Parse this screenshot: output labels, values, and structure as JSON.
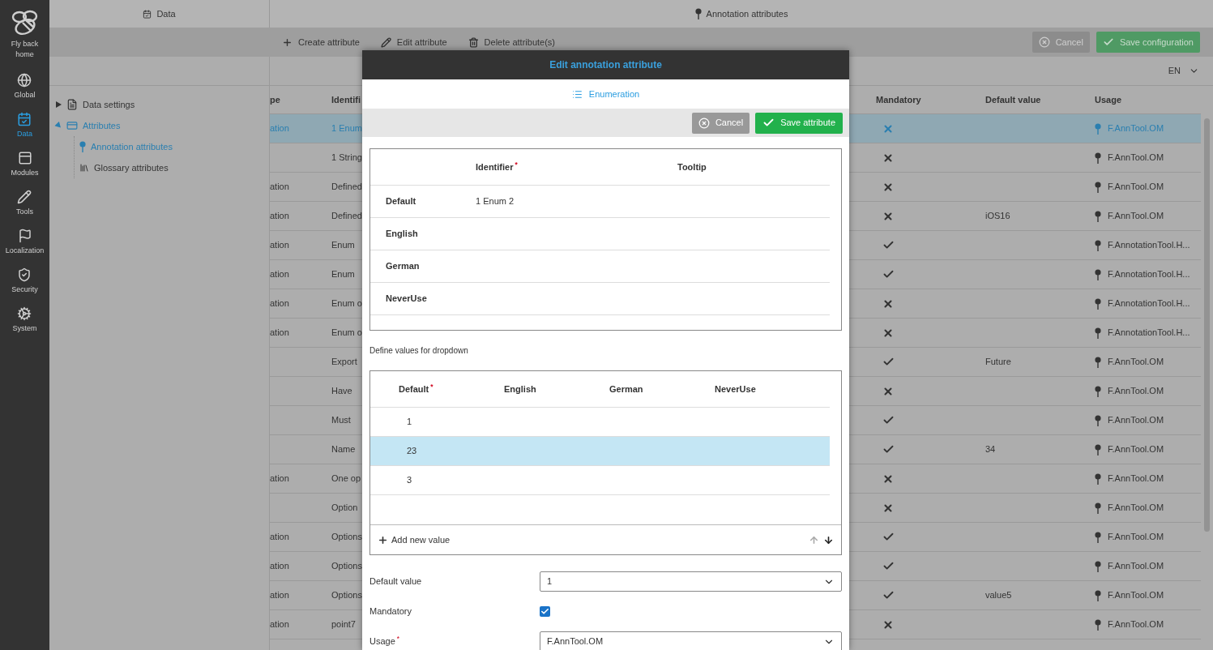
{
  "nav": {
    "home_label": "Fly back home",
    "items": [
      {
        "label": "Global",
        "selected": false
      },
      {
        "label": "Data",
        "selected": true
      },
      {
        "label": "Modules",
        "selected": false
      },
      {
        "label": "Tools",
        "selected": false
      },
      {
        "label": "Localization",
        "selected": false
      },
      {
        "label": "Security",
        "selected": false
      },
      {
        "label": "System",
        "selected": false
      }
    ]
  },
  "data_panel": {
    "title": "Data",
    "tree": [
      {
        "label": "Data settings",
        "expanded": false
      },
      {
        "label": "Attributes",
        "expanded": true,
        "children": [
          {
            "label": "Annotation attributes",
            "selected": true
          },
          {
            "label": "Glossary attributes",
            "selected": false
          }
        ]
      }
    ]
  },
  "main": {
    "title": "Annotation attributes",
    "toolbar": [
      "Create attribute",
      "Edit attribute",
      "Delete attribute(s)"
    ],
    "cancel": "Cancel",
    "save": "Save configuration",
    "language": "EN",
    "table": {
      "columns": [
        "pe",
        "Identifi",
        "Mandatory",
        "Default value",
        "Usage"
      ],
      "rows": [
        {
          "type": "ation",
          "identifier": "1 Enum",
          "mandatory": false,
          "usage": "F.AnnTool.OM",
          "selected": true
        },
        {
          "identifier": "1 String",
          "mandatory": false,
          "usage": "F.AnnTool.OM",
          "selected": false
        },
        {
          "type": "ation",
          "identifier": "Defined",
          "mandatory": false,
          "usage": "F.AnnTool.OM",
          "selected": false
        },
        {
          "type": "ation",
          "identifier": "Defined",
          "mandatory": false,
          "default_value": "iOS16",
          "usage": "F.AnnTool.OM",
          "selected": false
        },
        {
          "type": "ation",
          "identifier": "Enum",
          "mandatory": true,
          "usage": "F.AnnotationTool.H...",
          "selected": false
        },
        {
          "type": "ation",
          "identifier": "Enum",
          "mandatory": true,
          "usage": "F.AnnotationTool.H...",
          "selected": false
        },
        {
          "type": "ation",
          "identifier": "Enum o",
          "mandatory": false,
          "usage": "F.AnnotationTool.H...",
          "selected": false
        },
        {
          "type": "ation",
          "identifier": "Enum o",
          "mandatory": false,
          "usage": "F.AnnotationTool.H...",
          "selected": false
        },
        {
          "identifier": "Export",
          "mandatory": true,
          "default_value": "Future",
          "usage": "F.AnnTool.OM",
          "selected": false
        },
        {
          "identifier": "Have",
          "mandatory": false,
          "usage": "F.AnnTool.OM",
          "selected": false
        },
        {
          "identifier": "Must",
          "mandatory": true,
          "usage": "F.AnnTool.OM",
          "selected": false
        },
        {
          "identifier": "Name",
          "mandatory": true,
          "default_value": "34",
          "usage": "F.AnnTool.OM",
          "selected": false
        },
        {
          "type": "ation",
          "identifier": "One op",
          "mandatory": false,
          "usage": "F.AnnTool.OM",
          "selected": false
        },
        {
          "identifier": "Option",
          "mandatory": false,
          "usage": "F.AnnTool.OM",
          "selected": false
        },
        {
          "type": "ation",
          "identifier": "Options",
          "mandatory": true,
          "usage": "F.AnnTool.OM",
          "selected": false
        },
        {
          "type": "ation",
          "identifier": "Options",
          "mandatory": true,
          "usage": "F.AnnTool.OM",
          "selected": false
        },
        {
          "type": "ation",
          "identifier": "Options",
          "mandatory": true,
          "default_value": "value5",
          "usage": "F.AnnTool.OM",
          "selected": false
        },
        {
          "type": "ation",
          "identifier": "point7",
          "mandatory": false,
          "usage": "F.AnnTool.OM",
          "selected": false
        }
      ]
    }
  },
  "dialog": {
    "title": "Edit annotation attribute",
    "type_label": "Enumeration",
    "cancel": "Cancel",
    "save": "Save attribute",
    "translations": {
      "columns": [
        "Identifier$^{*}$",
        "Tooltip"
      ],
      "rows": [
        {
          "language": "Default",
          "identifier": "1 Enum 2"
        },
        {
          "language": "English"
        },
        {
          "language": "German"
        },
        {
          "language": "NeverUse"
        }
      ]
    },
    "values_heading": "Define values for dropdown",
    "values": {
      "columns": [
        "Default$^{*}$",
        "English",
        "German",
        "NeverUse"
      ],
      "rows": [
        {
          "default": "1",
          "selected": false
        },
        {
          "default": "23",
          "selected": true
        },
        {
          "default": "3",
          "selected": false
        }
      ],
      "add_label": "Add new value"
    },
    "fields": [
      {
        "kind": "select",
        "label": "Default value",
        "value": "1"
      },
      {
        "kind": "checkbox",
        "label": "Mandatory",
        "checked": true
      },
      {
        "kind": "select",
        "label": "Usage$^{*}$",
        "value": "F.AnnTool.OM"
      }
    ]
  }
}
